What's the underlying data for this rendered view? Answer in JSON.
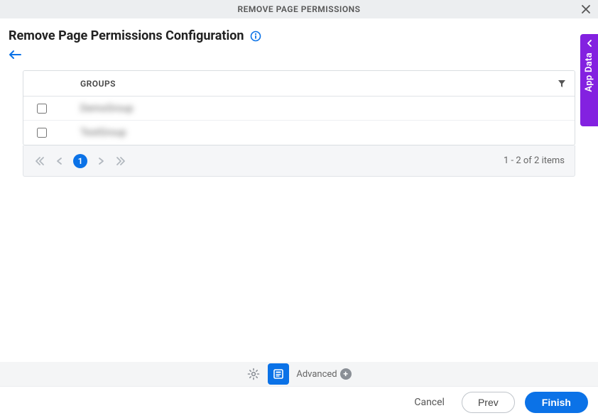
{
  "header": {
    "title": "REMOVE PAGE PERMISSIONS"
  },
  "page": {
    "title": "Remove Page Permissions Configuration"
  },
  "table": {
    "column_header": "GROUPS",
    "rows": [
      {
        "name": "DemoGroup"
      },
      {
        "name": "TestGroup"
      }
    ]
  },
  "pagination": {
    "current_page": "1",
    "summary": "1 - 2 of 2 items"
  },
  "side_tab": {
    "label": "App Data"
  },
  "toolbar": {
    "advanced_label": "Advanced"
  },
  "footer": {
    "cancel": "Cancel",
    "prev": "Prev",
    "finish": "Finish"
  }
}
